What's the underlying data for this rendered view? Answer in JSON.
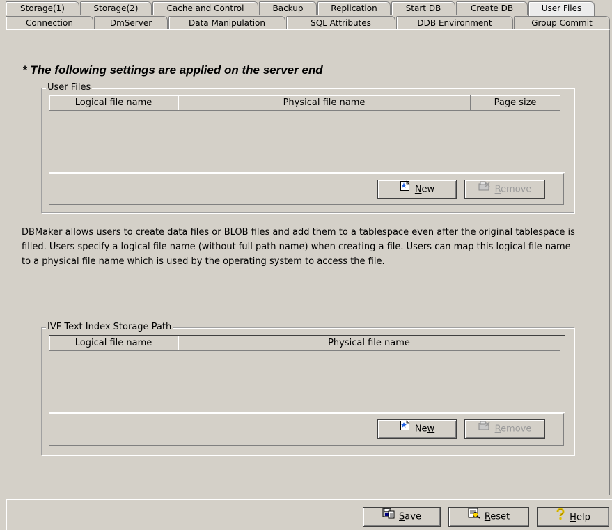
{
  "tabs_row1": [
    {
      "label": "Storage(1)"
    },
    {
      "label": "Storage(2)"
    },
    {
      "label": "Cache and Control"
    },
    {
      "label": "Backup"
    },
    {
      "label": "Replication"
    },
    {
      "label": "Start DB"
    },
    {
      "label": "Create DB"
    },
    {
      "label": "User Files",
      "active": true
    }
  ],
  "tabs_row2": [
    {
      "label": "Connection"
    },
    {
      "label": "DmServer"
    },
    {
      "label": "Data Manipulation"
    },
    {
      "label": "SQL Attributes"
    },
    {
      "label": "DDB Environment"
    },
    {
      "label": "Group Commit"
    }
  ],
  "heading": "* The following settings are applied on the server end",
  "user_files": {
    "title": "User Files",
    "columns": [
      "Logical file name",
      "Physical file name",
      "Page size"
    ],
    "rows": [],
    "new_button": {
      "prefix": "",
      "accel": "N",
      "suffix": "ew"
    },
    "remove_button": {
      "prefix": "",
      "accel": "R",
      "suffix": "emove",
      "enabled": false
    }
  },
  "description": "DBMaker allows users to create data files or BLOB files and add them to  a tablespace even after the original tablespace is filled. Users  specify a logical file name (without full path name) when creating a  file. Users can map this logical file name to a physical file name which is used by the operating system to access the file.",
  "ivf": {
    "title": "IVF Text Index Storage Path",
    "columns": [
      "Logical file name",
      "Physical file name"
    ],
    "rows": [],
    "new_button": {
      "prefix": "Ne",
      "accel": "w",
      "suffix": ""
    },
    "remove_button": {
      "prefix": "",
      "accel": "R",
      "suffix": "emove",
      "enabled": false
    }
  },
  "footer": {
    "save": {
      "prefix": "",
      "accel": "S",
      "suffix": "ave"
    },
    "reset": {
      "prefix": "",
      "accel": "R",
      "suffix": "eset"
    },
    "help": {
      "prefix": "",
      "accel": "H",
      "suffix": "elp"
    }
  },
  "icons": {
    "new": "new-file-icon",
    "remove": "remove-file-icon",
    "save": "save-icon",
    "reset": "reset-icon",
    "help": "help-icon"
  },
  "colors": {
    "background": "#d4d0c8",
    "disabled_text": "#9a9a9a"
  }
}
